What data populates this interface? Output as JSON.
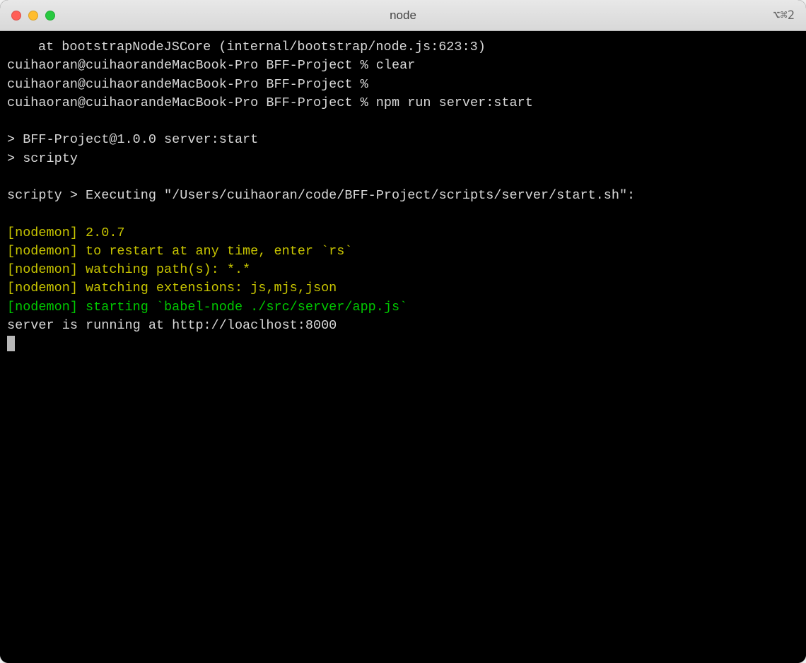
{
  "window": {
    "title": "node",
    "shortcut": "⌥⌘2"
  },
  "terminal": {
    "lines": [
      {
        "type": "plain-indent",
        "text": "at bootstrapNodeJSCore (internal/bootstrap/node.js:623:3)"
      },
      {
        "type": "plain",
        "text": "cuihaoran@cuihaorandeMacBook-Pro BFF-Project % clear"
      },
      {
        "type": "plain",
        "text": "cuihaoran@cuihaorandeMacBook-Pro BFF-Project % "
      },
      {
        "type": "plain",
        "text": "cuihaoran@cuihaorandeMacBook-Pro BFF-Project % npm run server:start"
      },
      {
        "type": "blank",
        "text": ""
      },
      {
        "type": "plain",
        "text": "> BFF-Project@1.0.0 server:start"
      },
      {
        "type": "plain",
        "text": "> scripty"
      },
      {
        "type": "blank",
        "text": ""
      },
      {
        "type": "plain",
        "text": "scripty > Executing \"/Users/cuihaoran/code/BFF-Project/scripts/server/start.sh\":"
      },
      {
        "type": "blank",
        "text": ""
      },
      {
        "type": "yellow",
        "text": "[nodemon] 2.0.7"
      },
      {
        "type": "yellow",
        "text": "[nodemon] to restart at any time, enter `rs`"
      },
      {
        "type": "yellow",
        "text": "[nodemon] watching path(s): *.*"
      },
      {
        "type": "yellow",
        "text": "[nodemon] watching extensions: js,mjs,json"
      },
      {
        "type": "green",
        "text": "[nodemon] starting `babel-node ./src/server/app.js`"
      },
      {
        "type": "plain",
        "text": "server is running at http://loaclhost:8000"
      }
    ]
  }
}
